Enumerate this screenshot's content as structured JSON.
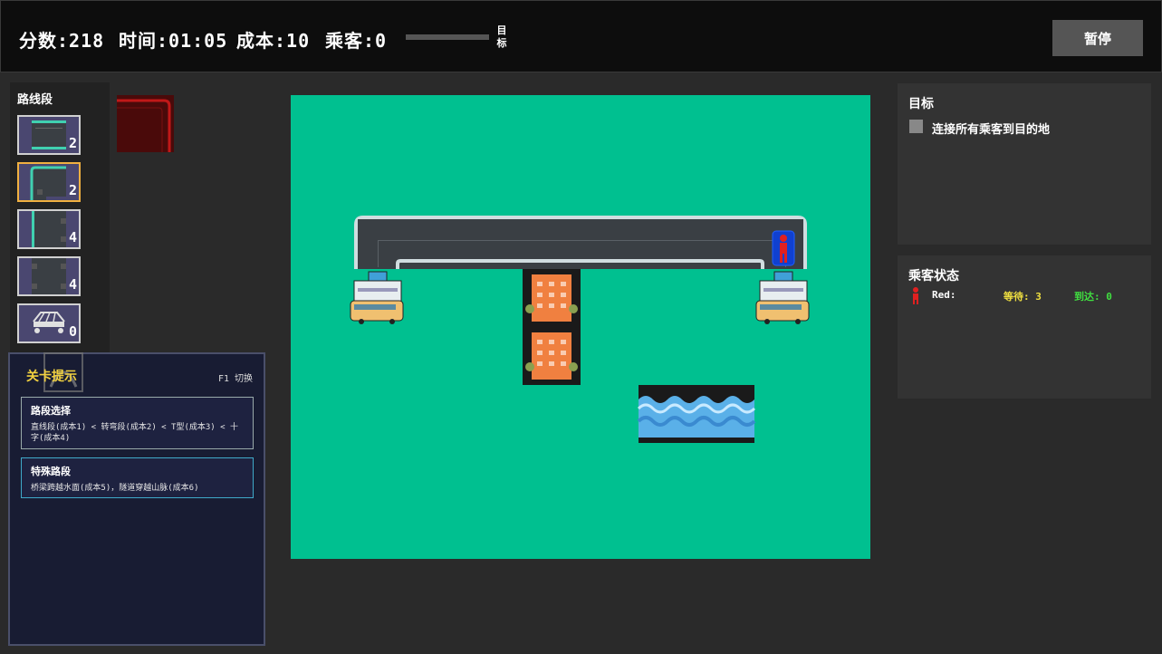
{
  "hud": {
    "score_label": "分数:",
    "score_value": "218",
    "time_label": "时间:",
    "time_value": "01:05",
    "cost_label": "成本:",
    "cost_value": "10",
    "passenger_label": "乘客:",
    "passenger_value": "0",
    "goal_mini_label": "目标",
    "progress": 0.0,
    "pause_label": "暂停"
  },
  "palette": {
    "title": "路线段",
    "items": [
      {
        "name": "straight",
        "count": "2"
      },
      {
        "name": "curve",
        "count": "2"
      },
      {
        "name": "t-junction",
        "count": "4"
      },
      {
        "name": "cross",
        "count": "4"
      },
      {
        "name": "bridge",
        "count": "0"
      }
    ]
  },
  "hint": {
    "title": "关卡提示",
    "shortcut": "F1 切换",
    "cards": [
      {
        "title": "路段选择",
        "body": "直线段(成本1) < 转弯段(成本2) < T型(成本3) < 十字(成本4)"
      },
      {
        "title": "特殊路段",
        "body": "桥梁跨越水面(成本5)，隧道穿越山脉(成本6)"
      }
    ]
  },
  "goal_panel": {
    "title": "目标",
    "objective": "连接所有乘客到目的地"
  },
  "status_panel": {
    "title": "乘客状态",
    "passengers": [
      {
        "name": "Red:",
        "waiting": "等待: 3",
        "arrived": "到达: 0",
        "color": "#e02020"
      }
    ]
  },
  "colors": {
    "board": "#00c090",
    "road": "#3a3f44",
    "road_edge": "#d0dde0",
    "water": "#5ab0e8",
    "building": "#f08040",
    "accent": "#f0b040"
  }
}
